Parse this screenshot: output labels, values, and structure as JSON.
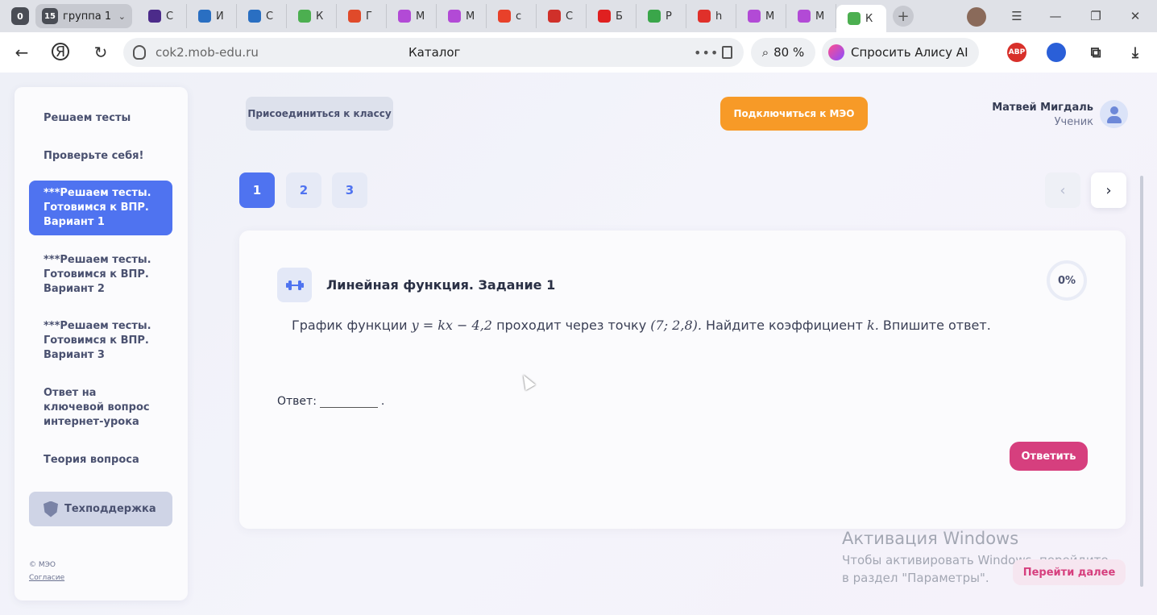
{
  "browser": {
    "tab_counter": "0",
    "group": {
      "count": "15",
      "label": "группа 1"
    },
    "tabs": [
      {
        "icon": "violet-icon",
        "letter": "С",
        "color": "#4c2b8a"
      },
      {
        "icon": "grid-icon",
        "letter": "И",
        "color": "#2a6fc2"
      },
      {
        "icon": "select-icon",
        "letter": "С",
        "color": "#2a6fc2"
      },
      {
        "icon": "diamond-icon",
        "letter": "К",
        "color": "#4caf50"
      },
      {
        "icon": "gd-icon",
        "letter": "Г",
        "color": "#e04a2a"
      },
      {
        "icon": "five-icon",
        "letter": "М",
        "color": "#b24ad6"
      },
      {
        "icon": "five-icon",
        "letter": "М",
        "color": "#b24ad6"
      },
      {
        "icon": "yandex-icon",
        "letter": "с",
        "color": "#e8412a"
      },
      {
        "icon": "music-icon",
        "letter": "С",
        "color": "#d0302a"
      },
      {
        "icon": "youtube-icon",
        "letter": "Б",
        "color": "#e02020"
      },
      {
        "icon": "arrow-icon",
        "letter": "Р",
        "color": "#3aa64a"
      },
      {
        "icon": "red-icon",
        "letter": "h",
        "color": "#e0302a"
      },
      {
        "icon": "five-icon",
        "letter": "М",
        "color": "#b24ad6"
      },
      {
        "icon": "five-icon",
        "letter": "М",
        "color": "#b24ad6"
      },
      {
        "icon": "diamond-icon",
        "letter": "К",
        "color": "#4caf50",
        "active": true
      }
    ],
    "url": "cok2.mob-edu.ru",
    "page_title": "Каталог",
    "zoom": "80 %",
    "alice_label": "Спросить Алису AI",
    "adblock_label": "ABP"
  },
  "sidebar": {
    "items": [
      {
        "label": "Решаем тесты",
        "active": false
      },
      {
        "label": "Проверьте себя!",
        "active": false
      },
      {
        "label": "***Решаем тесты. Готовимся к ВПР. Вариант 1",
        "active": true
      },
      {
        "label": "***Решаем тесты. Готовимся к ВПР. Вариант 2",
        "active": false
      },
      {
        "label": "***Решаем тесты. Готовимся к ВПР. Вариант 3",
        "active": false
      },
      {
        "label": "Ответ на ключевой вопрос интернет-урока",
        "active": false
      },
      {
        "label": "Теория вопроса",
        "active": false
      }
    ],
    "support_label": "Техподдержка",
    "copyright": "© МЭО",
    "agreement_link": "Согласие"
  },
  "header": {
    "join_class_label": "Присоединиться к классу",
    "connect_label": "Подключиться к МЭО",
    "user_name": "Матвей Мигдаль",
    "user_role": "Ученик"
  },
  "pagination": {
    "pages": [
      "1",
      "2",
      "3"
    ],
    "current": "1"
  },
  "task": {
    "title": "Линейная функция. Задание 1",
    "progress": "0%",
    "question_prefix": "График функции",
    "question_formula": "y = kx − 4,2",
    "question_middle": "проходит через точку",
    "question_point": "(7; 2,8).",
    "question_middle2": "Найдите коэффициент",
    "question_var": "k.",
    "question_suffix": "Впишите ответ.",
    "answer_label": "Ответ:",
    "answer_value": "",
    "answer_suffix": ".",
    "submit_label": "Ответить"
  },
  "next_page_label": "Перейти далее",
  "windows_activation": {
    "title": "Активация Windows",
    "text": "Чтобы активировать Windows, перейдите в раздел \"Параметры\"."
  }
}
